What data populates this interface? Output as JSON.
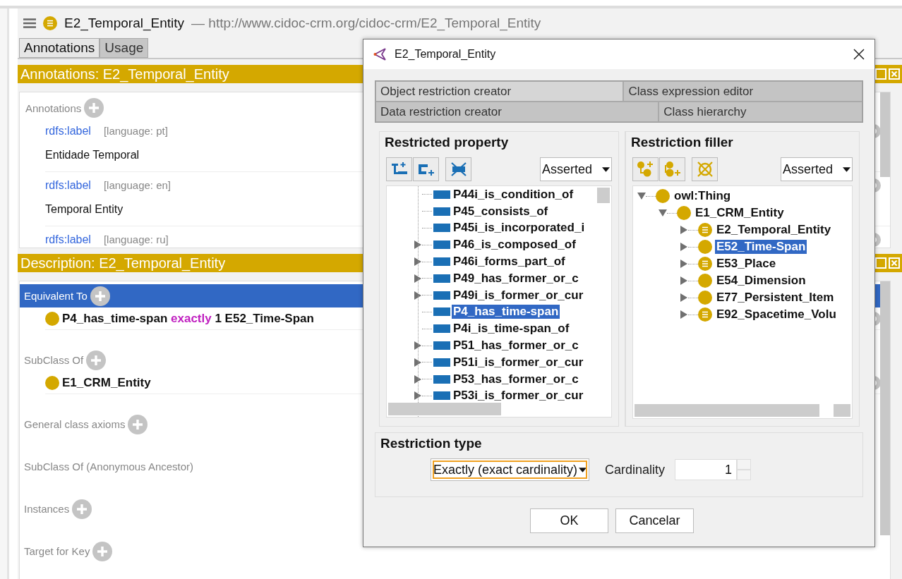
{
  "main": {
    "title": "E2_Temporal_Entity",
    "separator": "—",
    "iri": "http://www.cidoc-crm.org/cidoc-crm/E2_Temporal_Entity",
    "tabs": [
      {
        "label": "Annotations",
        "selected": true
      },
      {
        "label": "Usage",
        "selected": false
      }
    ],
    "annotations_view": {
      "header": "Annotations: E2_Temporal_Entity",
      "section_label": "Annotations",
      "items": [
        {
          "property": "rdfs:label",
          "language": "[language: pt]",
          "value": "Entidade Temporal"
        },
        {
          "property": "rdfs:label",
          "language": "[language: en]",
          "value": "Temporal Entity"
        },
        {
          "property": "rdfs:label",
          "language": "[language: ru]"
        }
      ]
    },
    "description_view": {
      "header": "Description: E2_Temporal_Entity",
      "sections": [
        {
          "label": "Equivalent To",
          "addable": true,
          "selected": true,
          "items": [
            {
              "kind": "restriction",
              "property": "P4_has_time-span",
              "keyword": "exactly",
              "cardinality": "1",
              "filler": "E52_Time-Span"
            }
          ]
        },
        {
          "label": "SubClass Of",
          "addable": true,
          "selected": false,
          "items": [
            {
              "kind": "class",
              "name": "E1_CRM_Entity"
            }
          ]
        },
        {
          "label": "General class axioms",
          "addable": true,
          "selected": false
        },
        {
          "label": "SubClass Of (Anonymous Ancestor)",
          "addable": false,
          "selected": false
        },
        {
          "label": "Instances",
          "addable": true,
          "selected": false
        },
        {
          "label": "Target for Key",
          "addable": true,
          "selected": false
        }
      ]
    }
  },
  "dialog": {
    "title": "E2_Temporal_Entity",
    "tab_rows": [
      [
        {
          "label": "Object restriction creator",
          "selected": true
        },
        {
          "label": "Class expression editor",
          "selected": false
        }
      ],
      [
        {
          "label": "Data restriction creator",
          "selected": false
        },
        {
          "label": "Class hierarchy",
          "selected": false
        }
      ]
    ],
    "restricted_property": {
      "title": "Restricted property",
      "view": "Asserted",
      "items": [
        {
          "name": "P44i_is_condition_of",
          "has_children": false,
          "selected": false
        },
        {
          "name": "P45_consists_of",
          "has_children": false,
          "selected": false
        },
        {
          "name": "P45i_is_incorporated_i",
          "has_children": false,
          "selected": false
        },
        {
          "name": "P46_is_composed_of",
          "has_children": true,
          "selected": false
        },
        {
          "name": "P46i_forms_part_of",
          "has_children": true,
          "selected": false
        },
        {
          "name": "P49_has_former_or_c",
          "has_children": true,
          "selected": false
        },
        {
          "name": "P49i_is_former_or_cur",
          "has_children": true,
          "selected": false
        },
        {
          "name": "P4_has_time-span",
          "has_children": false,
          "selected": true
        },
        {
          "name": "P4i_is_time-span_of",
          "has_children": false,
          "selected": false
        },
        {
          "name": "P51_has_former_or_c",
          "has_children": true,
          "selected": false
        },
        {
          "name": "P51i_is_former_or_cur",
          "has_children": true,
          "selected": false
        },
        {
          "name": "P53_has_former_or_c",
          "has_children": true,
          "selected": false
        },
        {
          "name": "P53i_is_former_or_cur",
          "has_children": true,
          "selected": false
        }
      ]
    },
    "restriction_filler": {
      "title": "Restriction filler",
      "view": "Asserted",
      "tree": [
        {
          "name": "owl:Thing",
          "kind": "primitive",
          "expanded": true,
          "selected": false,
          "children": [
            {
              "name": "E1_CRM_Entity",
              "kind": "primitive",
              "expanded": true,
              "selected": false,
              "children": [
                {
                  "name": "E2_Temporal_Entity",
                  "kind": "defined",
                  "expanded": false,
                  "selected": false
                },
                {
                  "name": "E52_Time-Span",
                  "kind": "primitive",
                  "expanded": false,
                  "selected": true
                },
                {
                  "name": "E53_Place",
                  "kind": "defined",
                  "expanded": false,
                  "selected": false
                },
                {
                  "name": "E54_Dimension",
                  "kind": "primitive",
                  "expanded": false,
                  "selected": false
                },
                {
                  "name": "E77_Persistent_Item",
                  "kind": "primitive",
                  "expanded": false,
                  "selected": false
                },
                {
                  "name": "E92_Spacetime_Volu",
                  "kind": "defined",
                  "expanded": false,
                  "selected": false
                }
              ]
            }
          ]
        }
      ]
    },
    "restriction_type": {
      "title": "Restriction type",
      "type": "Exactly (exact cardinality)",
      "cardinality_label": "Cardinality",
      "cardinality": "1"
    },
    "buttons": [
      "OK",
      "Cancelar"
    ]
  }
}
